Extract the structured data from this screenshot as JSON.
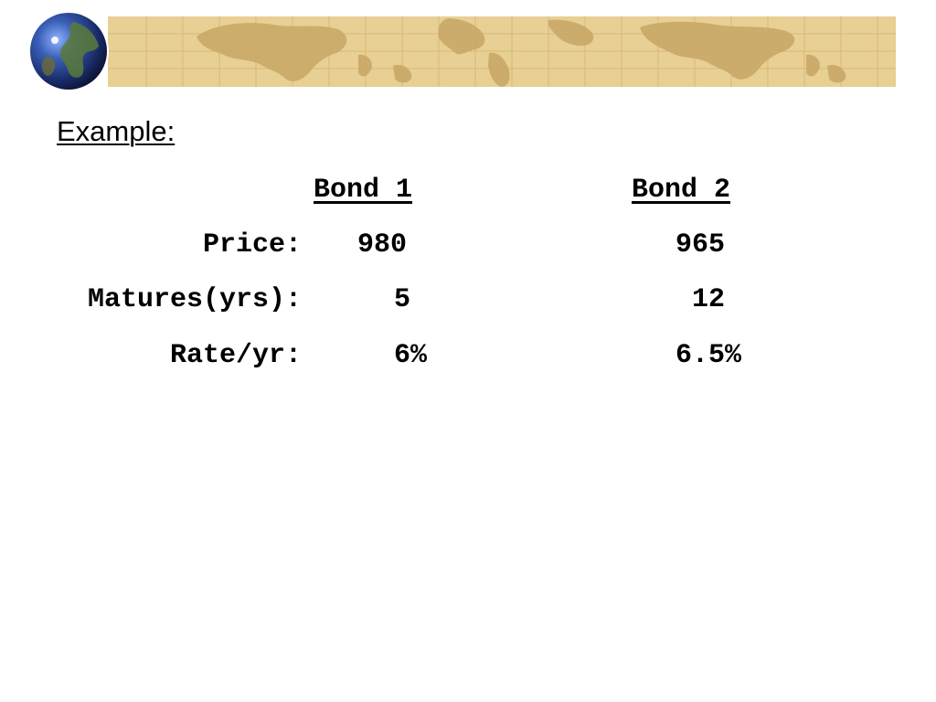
{
  "banner": {
    "globe_icon": "globe-icon",
    "map_color": "#e6cc8f",
    "continent_color": "#c9a867",
    "grid_color": "#d4b677"
  },
  "heading": "Example:",
  "columns": [
    "Bond 1",
    "Bond 2"
  ],
  "rows": [
    {
      "label": "Price:",
      "values": [
        "980",
        "965"
      ]
    },
    {
      "label": "Matures(yrs):",
      "values": [
        "5",
        "12"
      ]
    },
    {
      "label": "Rate/yr:",
      "values": [
        "6%",
        "6.5%"
      ]
    }
  ]
}
